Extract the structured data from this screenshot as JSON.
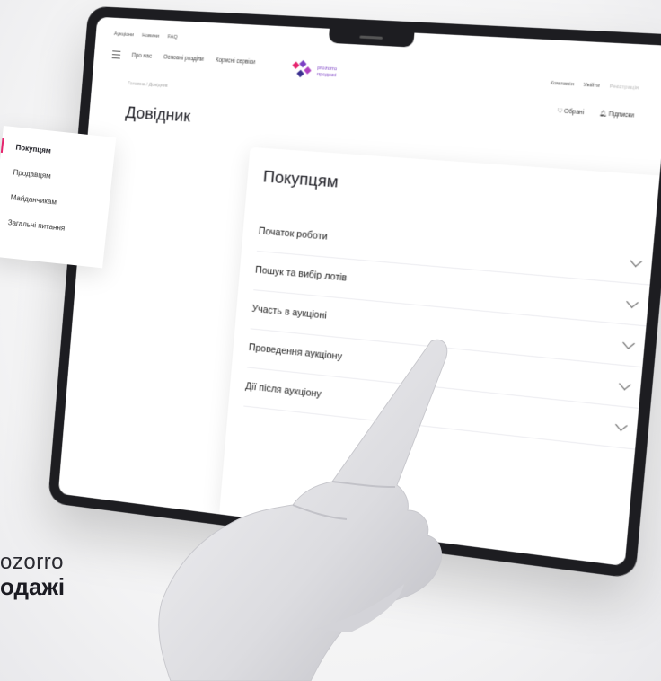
{
  "browser": {
    "topbar": [
      "Аукціони",
      "Новини",
      "FAQ"
    ],
    "nav_items": [
      "Про нас",
      "Основні розділи",
      "Корисні сервіси"
    ],
    "logo_lines": [
      "prozorro",
      "продажі"
    ],
    "auth_links": [
      "Компанія",
      "Увійти",
      "Реєстрація"
    ],
    "favorites_label": "Обрані",
    "subscriptions_label": "Підписки",
    "breadcrumb": "Головна / Довідник"
  },
  "page": {
    "title": "Довідник",
    "section_title": "Покупцям",
    "accordion": [
      "Початок роботи",
      "Пошук та вибір лотів",
      "Участь в аукціоні",
      "Проведення аукціону",
      "Дії після аукціону"
    ]
  },
  "sidebar": {
    "items": [
      "Покупцям",
      "Продавцям",
      "Майданчикам",
      "Загальні питання"
    ],
    "active_index": 0
  },
  "brand": {
    "line1": "ozorro",
    "line2": "одажі"
  },
  "colors": {
    "accent": "#e6246d",
    "brand_purple": "#7b3fc4",
    "bezel": "#1d1d21"
  }
}
